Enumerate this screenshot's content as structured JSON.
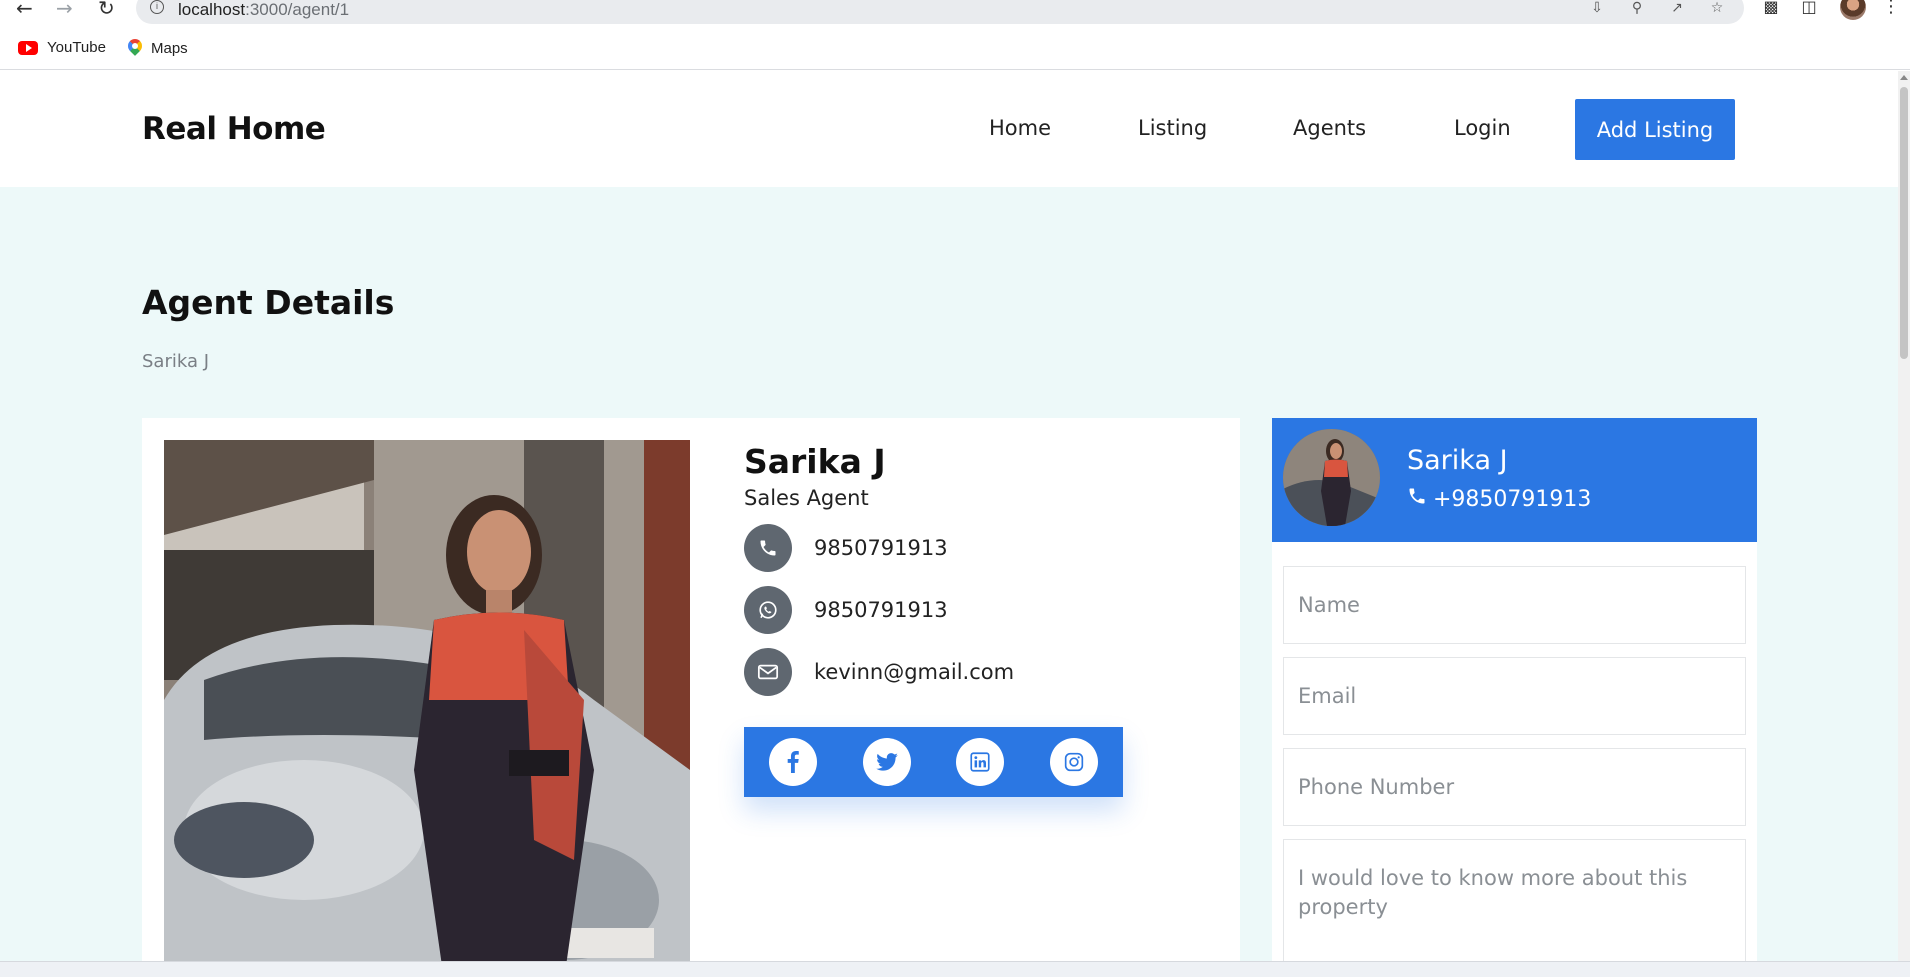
{
  "browser": {
    "url_host": "localhost",
    "url_path": ":3000/agent/1",
    "bookmarks": [
      {
        "label": "YouTube",
        "icon": "youtube-icon"
      },
      {
        "label": "Maps",
        "icon": "maps-icon"
      }
    ]
  },
  "site": {
    "brand": "Real Home",
    "nav": [
      "Home",
      "Listing",
      "Agents",
      "Login"
    ],
    "cta": "Add Listing",
    "accent": "#2b77e3",
    "page_bg": "#edf9f9"
  },
  "page": {
    "title": "Agent Details",
    "breadcrumb": "Sarika J"
  },
  "agent": {
    "name": "Sarika J",
    "role": "Sales Agent",
    "phone": "9850791913",
    "whatsapp": "9850791913",
    "email": "kevinn@gmail.com",
    "socials": [
      "facebook-icon",
      "twitter-icon",
      "linkedin-icon",
      "instagram-icon"
    ]
  },
  "contact_panel": {
    "name": "Sarika J",
    "phone": "+9850791913",
    "fields": {
      "name_placeholder": "Name",
      "email_placeholder": "Email",
      "phone_placeholder": "Phone Number",
      "message_placeholder": "I would love to know more about this property"
    }
  }
}
